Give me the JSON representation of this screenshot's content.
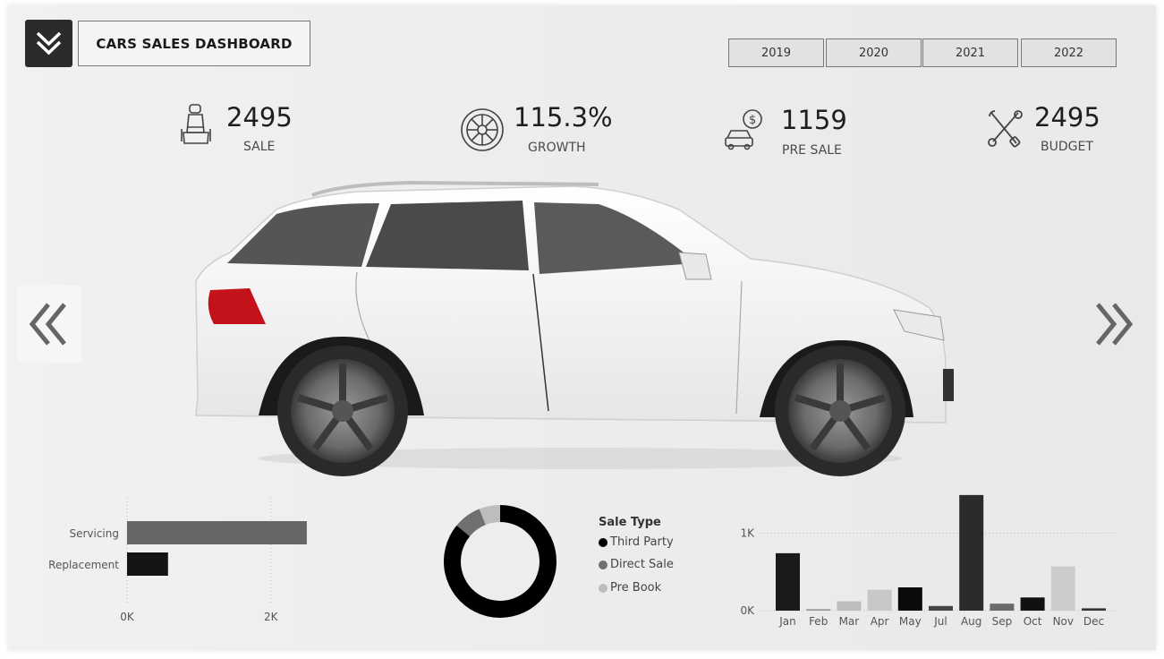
{
  "header": {
    "title": "CARS SALES DASHBOARD",
    "menu_icon": "double-chevron-down-icon",
    "years": [
      "2019",
      "2020",
      "2021",
      "2022"
    ]
  },
  "kpis": [
    {
      "value": "2495",
      "label": "SALE",
      "icon": "car-seat-icon"
    },
    {
      "value": "115.3%",
      "label": "GROWTH",
      "icon": "tire-icon"
    },
    {
      "value": "1159",
      "label": "PRE SALE",
      "icon": "car-dollar-icon"
    },
    {
      "value": "2495",
      "label": "BUDGET",
      "icon": "wrench-screwdriver-icon"
    }
  ],
  "navigation": {
    "prev_icon": "double-chevron-left-icon",
    "next_icon": "double-chevron-right-icon"
  },
  "hero_image": "white-suv-side-view",
  "colors": {
    "dark": "#1a1a1a",
    "mid": "#666666",
    "light": "#c8c8c8",
    "accent": "#2b2b2b"
  },
  "chart_data": [
    {
      "type": "bar",
      "orientation": "horizontal",
      "categories": [
        "Servicing",
        "Replacement"
      ],
      "values": [
        2500,
        570
      ],
      "bar_colors": [
        "#666666",
        "#141414"
      ],
      "xticks": [
        "0K",
        "2K"
      ],
      "xlim": [
        0,
        2700
      ],
      "tick_values": [
        0,
        2000
      ],
      "grid": true
    },
    {
      "type": "pie",
      "donut": true,
      "legend_title": "Sale Type",
      "labels": [
        "Third Party",
        "Direct Sale",
        "Pre Book"
      ],
      "values": [
        86,
        8,
        6
      ],
      "colors": [
        "#000000",
        "#707070",
        "#bdbdbd"
      ],
      "legend_position": "right"
    },
    {
      "type": "bar",
      "categories": [
        "Jan",
        "Feb",
        "Mar",
        "Apr",
        "May",
        "Jul",
        "Aug",
        "Sep",
        "Oct",
        "Nov",
        "Dec"
      ],
      "values": [
        740,
        20,
        120,
        270,
        300,
        60,
        1490,
        90,
        170,
        570,
        30
      ],
      "bar_colors": [
        "#1a1a1a",
        "#9a9a9a",
        "#bdbdbd",
        "#c8c8c8",
        "#0a0a0a",
        "#444444",
        "#2b2b2b",
        "#6a6a6a",
        "#111111",
        "#cccccc",
        "#333333"
      ],
      "yticks": [
        "0K",
        "1K"
      ],
      "tick_values": [
        0,
        1000
      ],
      "ylim": [
        0,
        1500
      ],
      "grid": true
    }
  ]
}
